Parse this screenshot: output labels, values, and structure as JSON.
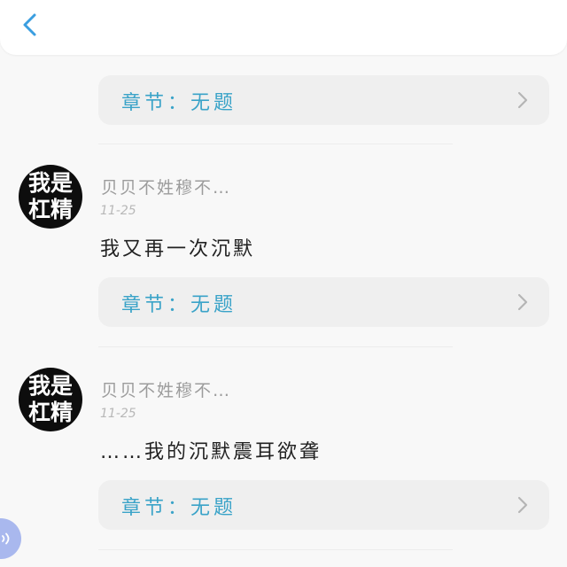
{
  "header": {
    "back_icon": "chevron-left-icon",
    "accent_color": "#3a9ee0"
  },
  "sections": [
    {
      "chapter": {
        "label": "章节：无题",
        "arrow_icon": "chevron-right-icon"
      }
    },
    {
      "comment": {
        "avatar_lines": [
          "我是",
          "杠精"
        ],
        "user_name": "贝贝不姓穆不…",
        "date": "11-25",
        "text": "我又再一次沉默"
      },
      "chapter": {
        "label": "章节：无题",
        "arrow_icon": "chevron-right-icon"
      }
    },
    {
      "comment": {
        "avatar_lines": [
          "我是",
          "杠精"
        ],
        "user_name": "贝贝不姓穆不…",
        "date": "11-25",
        "text": "……我的沉默震耳欲聋"
      },
      "chapter": {
        "label": "章节：无题",
        "arrow_icon": "chevron-right-icon"
      }
    }
  ],
  "floating_button": {
    "icon": "sound-icon",
    "color": "#a9b8ee"
  },
  "colors": {
    "chapter_text": "#3aa3c8",
    "card_background": "#efefef",
    "avatar_background": "#0d0d0d"
  }
}
